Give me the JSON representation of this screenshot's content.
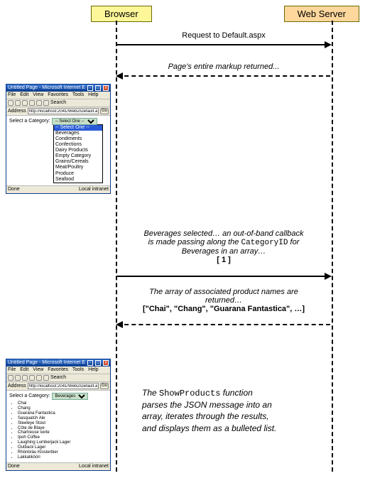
{
  "participants": {
    "browser": "Browser",
    "server": "Web Server"
  },
  "msg1": {
    "label": "Request to Default.aspx"
  },
  "msg2": {
    "label": "Page's entire markup returned..."
  },
  "msg3": {
    "line1": "Beverages selected… an out-of-band callback",
    "line2a": "is made passing along the ",
    "line2b_mono": "CategoryID",
    "line2c": " for",
    "line3": "Beverages in an array…",
    "payload": "[ 1 ]"
  },
  "msg4": {
    "line1": "The array of associated product names are",
    "line2": "returned…",
    "payload": "[\"Chai\", \"Chang\", \"Guarana Fantastica\", …]"
  },
  "caption": {
    "a": "The ",
    "fn": "ShowProducts",
    "b": " function parses the JSON message into an array, iterates through the results, and displays them as a bulleted list."
  },
  "ie": {
    "title": "Untitled Page - Microsoft Internet E",
    "menu": {
      "file": "File",
      "edit": "Edit",
      "view": "View",
      "fav": "Favorites",
      "tools": "Tools",
      "help": "Help"
    },
    "search": "Search",
    "addr_label": "Address",
    "url": "http://localhost:2041/Web2/Default.aspx",
    "go": "Go",
    "status_left": "Done",
    "status_right": "Local intranet",
    "cat_label": "Select a Category:"
  },
  "dropdown": {
    "selected": "-- Select One --",
    "options": [
      "-- Select One --",
      "Beverages",
      "Condiments",
      "Confections",
      "Dairy Products",
      "Empty Category",
      "Grains/Cereals",
      "Meat/Poultry",
      "Produce",
      "Seafood"
    ]
  },
  "result": {
    "selected": "Beverages",
    "products": [
      "Chai",
      "Chang",
      "Guarana Fantastica",
      "Sasquatch Ale",
      "Steeleye Stout",
      "Côte de Blaye",
      "Chartreuse verte",
      "Ipoh Coffee",
      "Laughing Lumberjack Lager",
      "Outback Lager",
      "Rhönbräu Klosterbier",
      "Lakkalikööri"
    ]
  }
}
